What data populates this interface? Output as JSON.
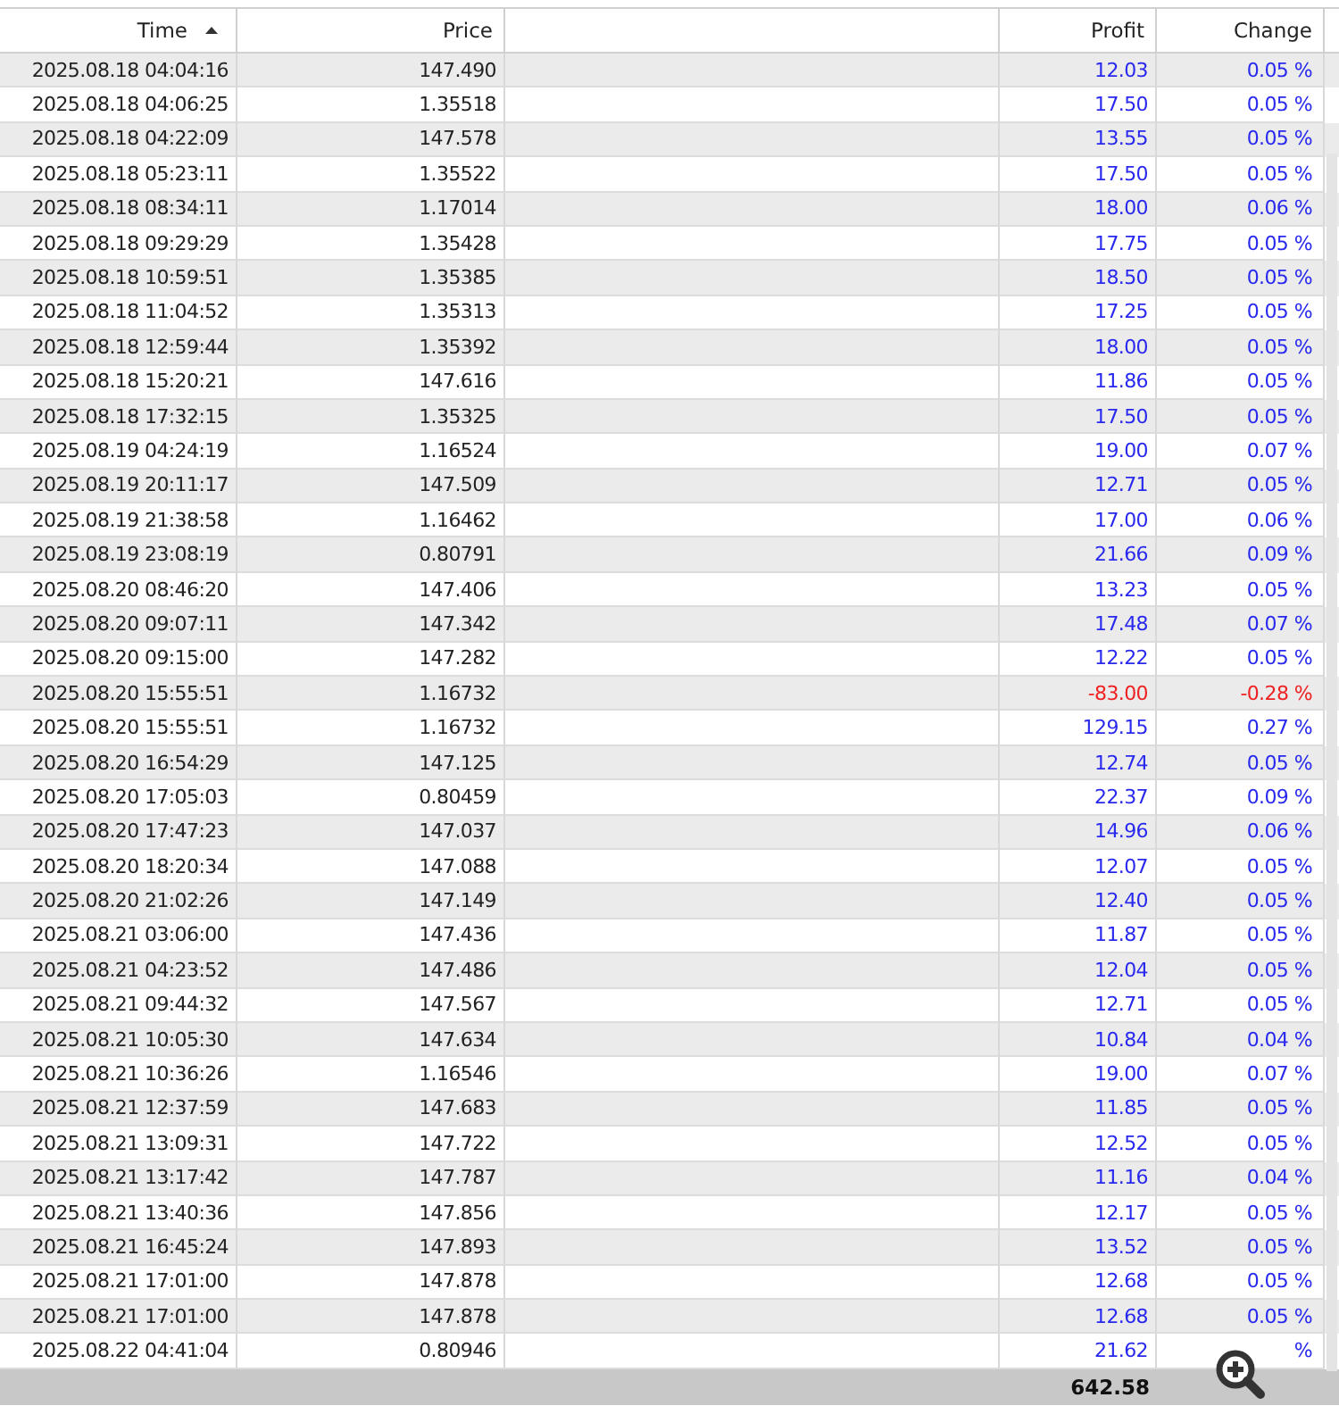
{
  "table": {
    "columns": [
      {
        "label": "Time",
        "sorted": true
      },
      {
        "label": "Price",
        "sorted": false
      },
      {
        "sorted": false
      },
      {
        "label": "Profit",
        "sorted": false
      },
      {
        "label": "Change",
        "sorted": false
      }
    ],
    "rows": [
      {
        "time": "2025.08.18 04:04:16",
        "price": "147.490",
        "profit": "12.03",
        "change": "0.05 %",
        "loss": false
      },
      {
        "time": "2025.08.18 04:06:25",
        "price": "1.35518",
        "profit": "17.50",
        "change": "0.05 %",
        "loss": false
      },
      {
        "time": "2025.08.18 04:22:09",
        "price": "147.578",
        "profit": "13.55",
        "change": "0.05 %",
        "loss": false
      },
      {
        "time": "2025.08.18 05:23:11",
        "price": "1.35522",
        "profit": "17.50",
        "change": "0.05 %",
        "loss": false
      },
      {
        "time": "2025.08.18 08:34:11",
        "price": "1.17014",
        "profit": "18.00",
        "change": "0.06 %",
        "loss": false
      },
      {
        "time": "2025.08.18 09:29:29",
        "price": "1.35428",
        "profit": "17.75",
        "change": "0.05 %",
        "loss": false
      },
      {
        "time": "2025.08.18 10:59:51",
        "price": "1.35385",
        "profit": "18.50",
        "change": "0.05 %",
        "loss": false
      },
      {
        "time": "2025.08.18 11:04:52",
        "price": "1.35313",
        "profit": "17.25",
        "change": "0.05 %",
        "loss": false
      },
      {
        "time": "2025.08.18 12:59:44",
        "price": "1.35392",
        "profit": "18.00",
        "change": "0.05 %",
        "loss": false
      },
      {
        "time": "2025.08.18 15:20:21",
        "price": "147.616",
        "profit": "11.86",
        "change": "0.05 %",
        "loss": false
      },
      {
        "time": "2025.08.18 17:32:15",
        "price": "1.35325",
        "profit": "17.50",
        "change": "0.05 %",
        "loss": false
      },
      {
        "time": "2025.08.19 04:24:19",
        "price": "1.16524",
        "profit": "19.00",
        "change": "0.07 %",
        "loss": false
      },
      {
        "time": "2025.08.19 20:11:17",
        "price": "147.509",
        "profit": "12.71",
        "change": "0.05 %",
        "loss": false
      },
      {
        "time": "2025.08.19 21:38:58",
        "price": "1.16462",
        "profit": "17.00",
        "change": "0.06 %",
        "loss": false
      },
      {
        "time": "2025.08.19 23:08:19",
        "price": "0.80791",
        "profit": "21.66",
        "change": "0.09 %",
        "loss": false
      },
      {
        "time": "2025.08.20 08:46:20",
        "price": "147.406",
        "profit": "13.23",
        "change": "0.05 %",
        "loss": false
      },
      {
        "time": "2025.08.20 09:07:11",
        "price": "147.342",
        "profit": "17.48",
        "change": "0.07 %",
        "loss": false
      },
      {
        "time": "2025.08.20 09:15:00",
        "price": "147.282",
        "profit": "12.22",
        "change": "0.05 %",
        "loss": false
      },
      {
        "time": "2025.08.20 15:55:51",
        "price": "1.16732",
        "profit": "-83.00",
        "change": "-0.28 %",
        "loss": true
      },
      {
        "time": "2025.08.20 15:55:51",
        "price": "1.16732",
        "profit": "129.15",
        "change": "0.27 %",
        "loss": false
      },
      {
        "time": "2025.08.20 16:54:29",
        "price": "147.125",
        "profit": "12.74",
        "change": "0.05 %",
        "loss": false
      },
      {
        "time": "2025.08.20 17:05:03",
        "price": "0.80459",
        "profit": "22.37",
        "change": "0.09 %",
        "loss": false
      },
      {
        "time": "2025.08.20 17:47:23",
        "price": "147.037",
        "profit": "14.96",
        "change": "0.06 %",
        "loss": false
      },
      {
        "time": "2025.08.20 18:20:34",
        "price": "147.088",
        "profit": "12.07",
        "change": "0.05 %",
        "loss": false
      },
      {
        "time": "2025.08.20 21:02:26",
        "price": "147.149",
        "profit": "12.40",
        "change": "0.05 %",
        "loss": false
      },
      {
        "time": "2025.08.21 03:06:00",
        "price": "147.436",
        "profit": "11.87",
        "change": "0.05 %",
        "loss": false
      },
      {
        "time": "2025.08.21 04:23:52",
        "price": "147.486",
        "profit": "12.04",
        "change": "0.05 %",
        "loss": false
      },
      {
        "time": "2025.08.21 09:44:32",
        "price": "147.567",
        "profit": "12.71",
        "change": "0.05 %",
        "loss": false
      },
      {
        "time": "2025.08.21 10:05:30",
        "price": "147.634",
        "profit": "10.84",
        "change": "0.04 %",
        "loss": false
      },
      {
        "time": "2025.08.21 10:36:26",
        "price": "1.16546",
        "profit": "19.00",
        "change": "0.07 %",
        "loss": false
      },
      {
        "time": "2025.08.21 12:37:59",
        "price": "147.683",
        "profit": "11.85",
        "change": "0.05 %",
        "loss": false
      },
      {
        "time": "2025.08.21 13:09:31",
        "price": "147.722",
        "profit": "12.52",
        "change": "0.05 %",
        "loss": false
      },
      {
        "time": "2025.08.21 13:17:42",
        "price": "147.787",
        "profit": "11.16",
        "change": "0.04 %",
        "loss": false
      },
      {
        "time": "2025.08.21 13:40:36",
        "price": "147.856",
        "profit": "12.17",
        "change": "0.05 %",
        "loss": false
      },
      {
        "time": "2025.08.21 16:45:24",
        "price": "147.893",
        "profit": "13.52",
        "change": "0.05 %",
        "loss": false
      },
      {
        "time": "2025.08.21 17:01:00",
        "price": "147.878",
        "profit": "12.68",
        "change": "0.05 %",
        "loss": false
      },
      {
        "time": "2025.08.21 17:01:00",
        "price": "147.878",
        "profit": "12.68",
        "change": "0.05 %",
        "loss": false
      },
      {
        "time": "2025.08.22 04:41:04",
        "price": "0.80946",
        "profit": "21.62",
        "change": "%",
        "loss": false
      }
    ],
    "total": {
      "profit": "642.58"
    }
  },
  "zoom_button": true
}
